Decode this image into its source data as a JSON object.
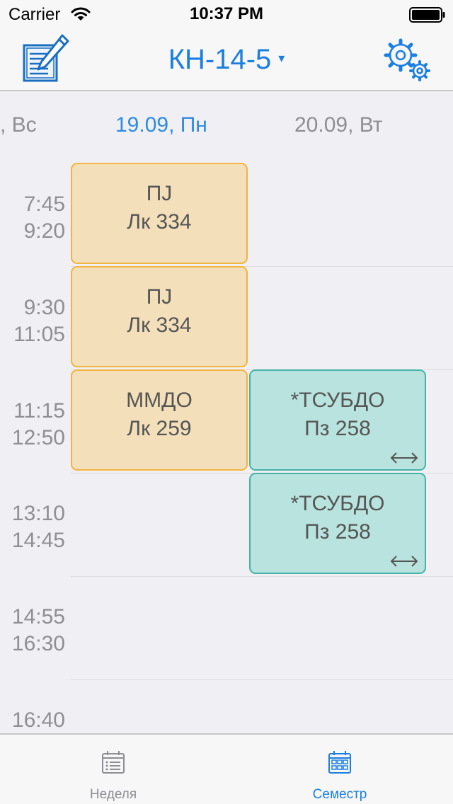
{
  "status_bar": {
    "carrier": "Carrier",
    "time": "10:37 PM"
  },
  "nav": {
    "title": "КН-14-5",
    "caret": "▾"
  },
  "days": [
    {
      "label": ", Вс"
    },
    {
      "label": "19.09, Пн",
      "active": true
    },
    {
      "label": "20.09, Вт"
    }
  ],
  "time_slots": [
    {
      "start": "7:45",
      "end": "9:20"
    },
    {
      "start": "9:30",
      "end": "11:05"
    },
    {
      "start": "11:15",
      "end": "12:50"
    },
    {
      "start": "13:10",
      "end": "14:45"
    },
    {
      "start": "14:55",
      "end": "16:30"
    },
    {
      "start": "16:40",
      "end": ""
    }
  ],
  "lessons": [
    {
      "subject": "ПJ",
      "room": "Лк 334",
      "type": "lecture"
    },
    {
      "subject": "ПJ",
      "room": "Лк 334",
      "type": "lecture"
    },
    {
      "subject": "ММДО",
      "room": "Лк 259",
      "type": "lecture"
    },
    {
      "subject": "*ТСУБДО",
      "room": "Пз 258",
      "type": "practice",
      "swap": true
    },
    {
      "subject": "*ТСУБДО",
      "room": "Пз 258",
      "type": "practice",
      "swap": true
    }
  ],
  "colors": {
    "accent": "#1a7fe0",
    "lecture_bg": "#f3dfba",
    "lecture_border": "#f2b53f",
    "practice_bg": "#b9e3df",
    "practice_border": "#46b3a6"
  },
  "tabs": [
    {
      "label": "Неделя",
      "icon": "list-calendar-icon",
      "active": false
    },
    {
      "label": "Семестр",
      "icon": "grid-calendar-icon",
      "active": true
    }
  ]
}
